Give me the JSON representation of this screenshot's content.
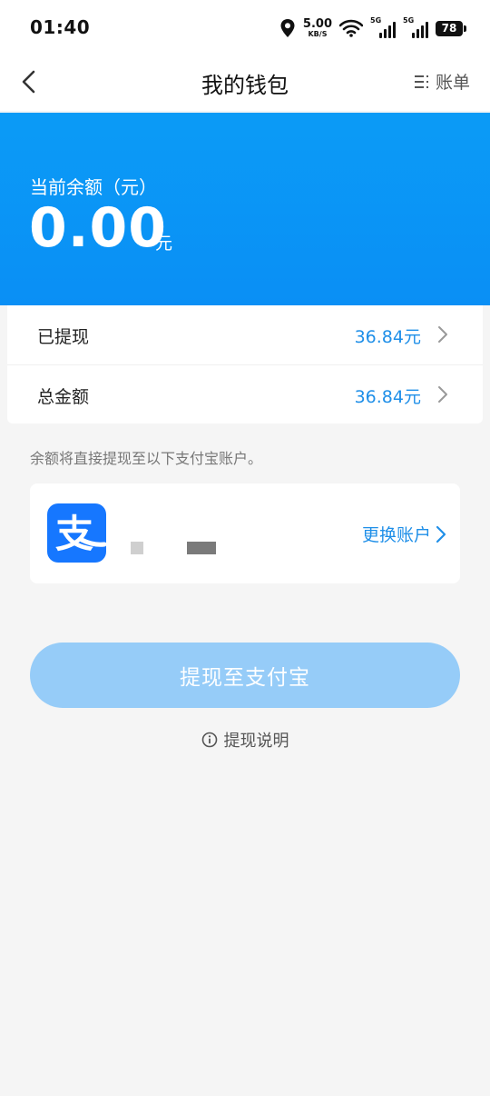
{
  "status_bar": {
    "time": "01:40",
    "net_speed_value": "5.00",
    "net_speed_unit": "KB/S",
    "sim1_tag": "5G",
    "sim2_tag": "5G",
    "battery": "78"
  },
  "nav": {
    "title": "我的钱包",
    "bill_label": "账单"
  },
  "balance": {
    "label": "当前余额（元）",
    "amount": "0.00",
    "unit": "元"
  },
  "summary": {
    "rows": [
      {
        "label": "已提现",
        "value": "36.84元"
      },
      {
        "label": "总金额",
        "value": "36.84元"
      }
    ]
  },
  "hint": "余额将直接提现至以下支付宝账户。",
  "account": {
    "logo_glyph": "支",
    "change_label": "更换账户"
  },
  "withdraw_button": "提现至支付宝",
  "withdraw_info": "提现说明",
  "colors": {
    "banner_blue": "#0a8ff5",
    "accent_blue": "#1f8fe8",
    "alipay_blue": "#1677ff",
    "button_disabled": "#96ccf8",
    "page_bg": "#f5f5f5"
  },
  "icons": {
    "back": "chevron-left-icon",
    "bill": "list-icon",
    "row_arrow": "chevron-right-icon",
    "info": "info-circle-icon",
    "location": "location-pin-icon",
    "wifi": "wifi-icon",
    "signal": "signal-bars-icon",
    "battery": "battery-icon"
  }
}
